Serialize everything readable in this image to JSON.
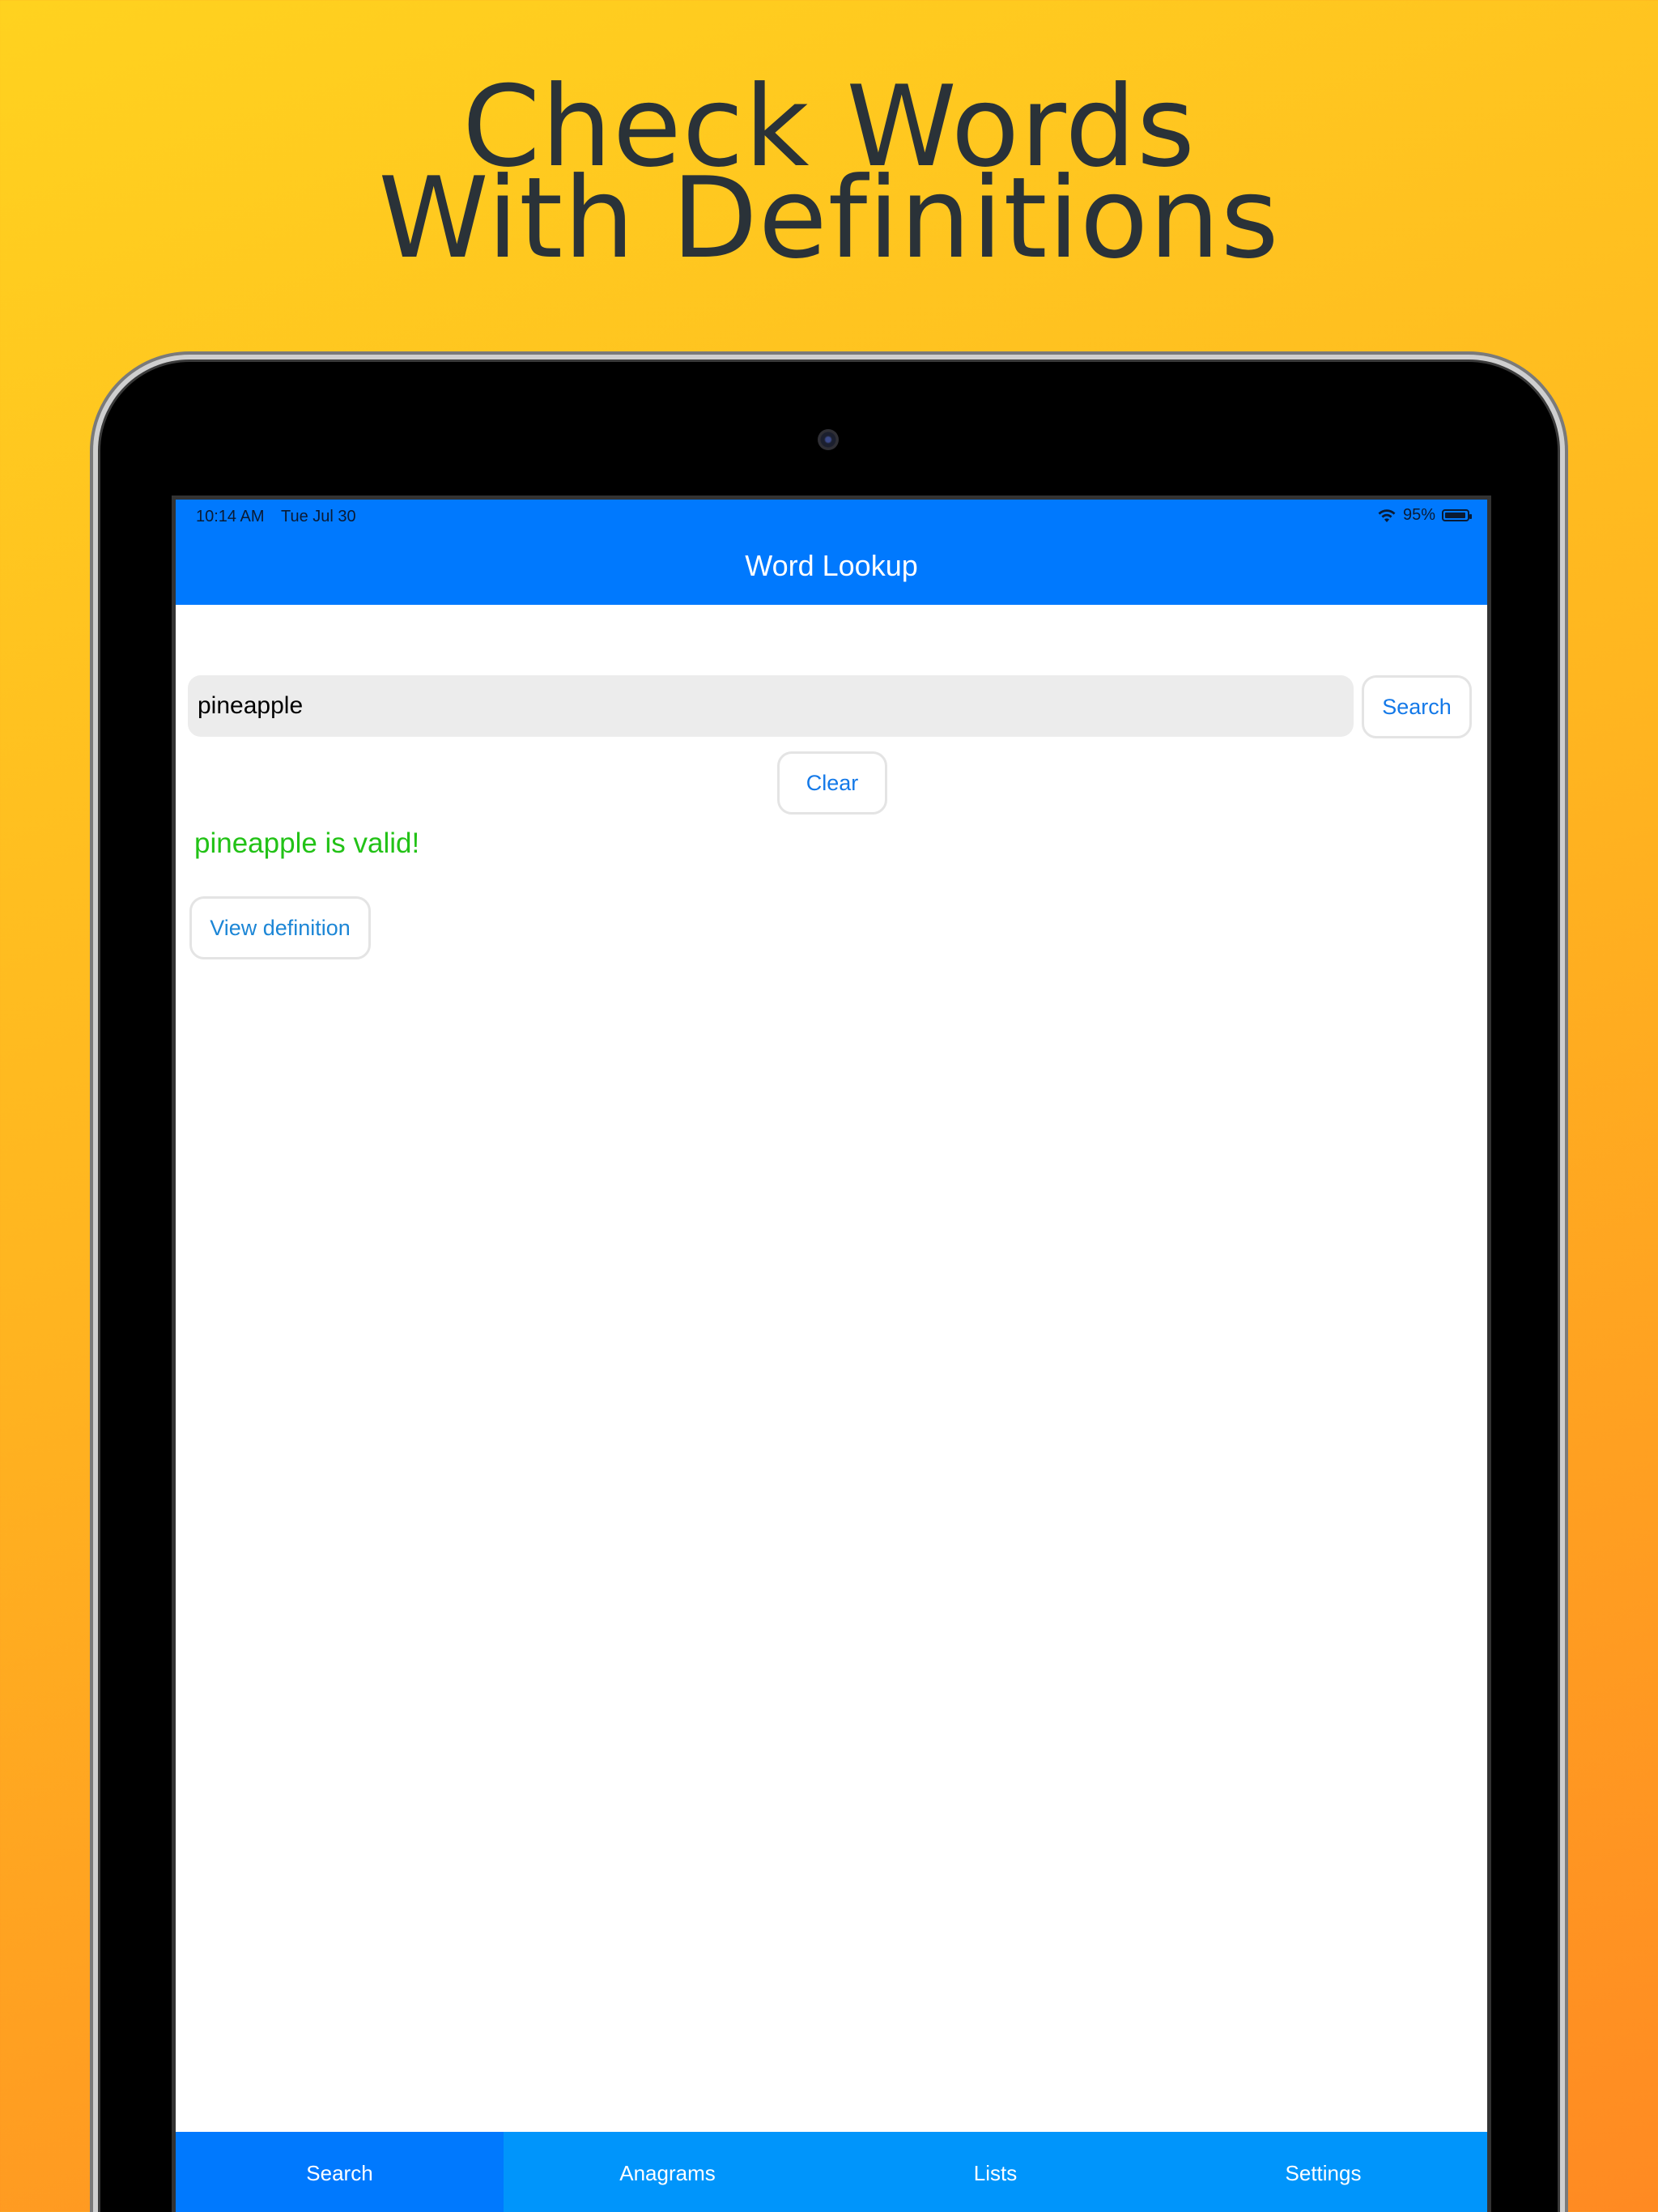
{
  "headline": {
    "line1": "Check Words",
    "line2": "With Definitions"
  },
  "status_bar": {
    "time": "10:14 AM",
    "date": "Tue Jul 30",
    "battery_text": "95%",
    "battery_level": 0.95,
    "wifi_icon": "wifi-icon",
    "battery_icon": "battery-icon"
  },
  "nav": {
    "title": "Word Lookup"
  },
  "search": {
    "value": "pineapple",
    "placeholder": "",
    "search_label": "Search",
    "clear_label": "Clear"
  },
  "result": {
    "message": "pineapple is valid!",
    "definition_label": "View definition"
  },
  "tabs": [
    {
      "label": "Search",
      "active": true
    },
    {
      "label": "Anagrams",
      "active": false
    },
    {
      "label": "Lists",
      "active": false
    },
    {
      "label": "Settings",
      "active": false
    }
  ],
  "colors": {
    "nav_bar": "#0079fe",
    "tab_bar": "#0095fb",
    "valid_text": "#22c216",
    "button_text": "#1479e8",
    "headline_text": "#2a3238"
  }
}
